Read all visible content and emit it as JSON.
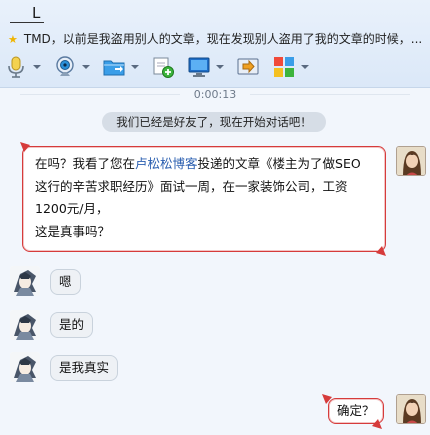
{
  "header": {
    "contact_name": "L",
    "signature": "TMD，以前是我盗用别人的文章，现在发现别人盗用了我的文章的时候，...",
    "toolbar": [
      {
        "name": "voice",
        "icon": "microphone-icon"
      },
      {
        "name": "video",
        "icon": "webcam-icon"
      },
      {
        "name": "send-file",
        "icon": "folder-icon"
      },
      {
        "name": "add-app",
        "icon": "add-app-icon"
      },
      {
        "name": "remote-assist",
        "icon": "monitor-icon"
      },
      {
        "name": "share-screen",
        "icon": "share-screen-icon"
      },
      {
        "name": "apps",
        "icon": "apps-grid-icon"
      }
    ]
  },
  "chat": {
    "timer": "0:00:13",
    "system_message": "我们已经是好友了，现在开始对话吧！",
    "first_message": {
      "line1_a": "在吗？我看了您在",
      "line1_link": "卢松松博客",
      "line1_b": "投递的文章《楼主为了做SEO",
      "line2": "这行的辛苦求职经历》面试一周，在一家装饰公司，工资",
      "line3": "1200元/月，",
      "line4": "这是真事吗？"
    },
    "replies": [
      "嗯",
      "是的",
      "是我真实"
    ],
    "last_message": "确定？"
  },
  "colors": {
    "header_bg": "#dbe8f8",
    "chat_bg": "#f2f6fc",
    "outgoing_border": "#d63b3b",
    "link": "#2b5fb0"
  }
}
